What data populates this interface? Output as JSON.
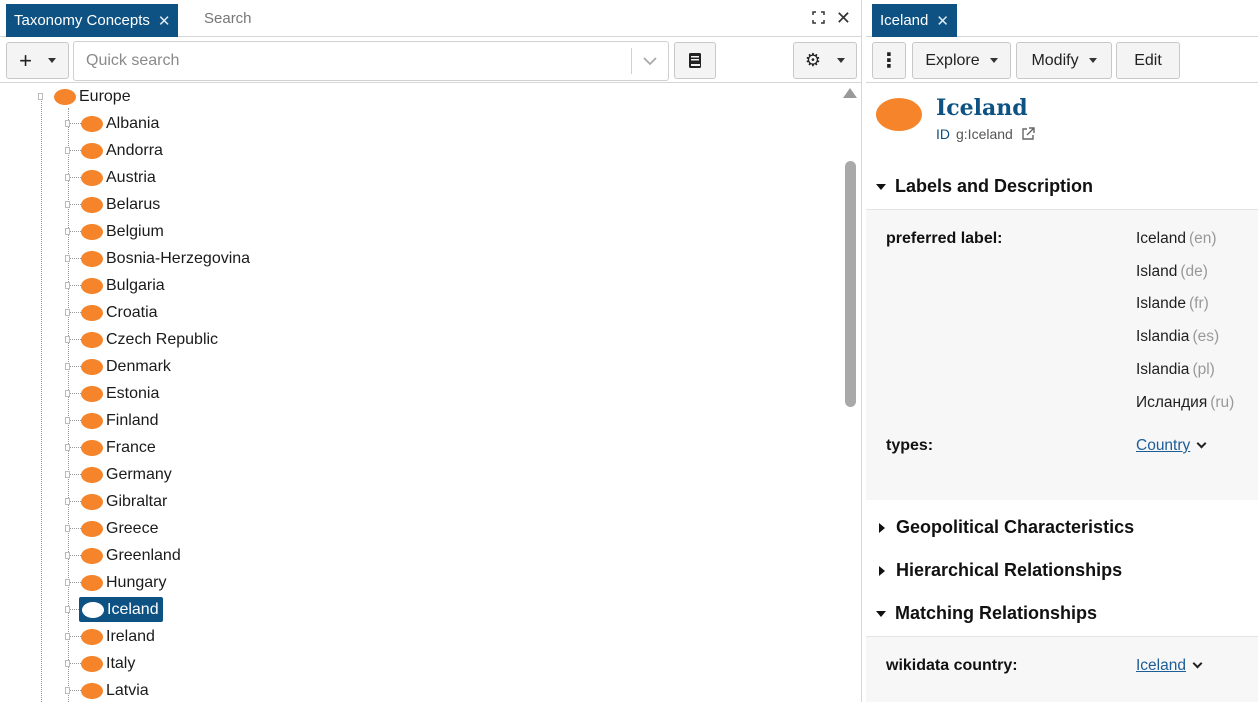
{
  "left_panel": {
    "tab_title": "Taxonomy Concepts",
    "tab_search_label": "Search",
    "quick_search_placeholder": "Quick search",
    "tree": {
      "root": "Europe",
      "children": [
        "Albania",
        "Andorra",
        "Austria",
        "Belarus",
        "Belgium",
        "Bosnia-Herzegovina",
        "Bulgaria",
        "Croatia",
        "Czech Republic",
        "Denmark",
        "Estonia",
        "Finland",
        "France",
        "Germany",
        "Gibraltar",
        "Greece",
        "Greenland",
        "Hungary",
        "Iceland",
        "Ireland",
        "Italy",
        "Latvia"
      ],
      "selected": "Iceland"
    }
  },
  "right_panel": {
    "tab_title": "Iceland",
    "toolbar": {
      "explore": "Explore",
      "modify": "Modify",
      "edit": "Edit"
    },
    "concept": {
      "title": "Iceland",
      "id_label": "ID",
      "id_value": "g:Iceland"
    },
    "sections": {
      "labels": "Labels and Description",
      "geopolitical": "Geopolitical Characteristics",
      "hierarchical": "Hierarchical Relationships",
      "matching": "Matching Relationships"
    },
    "preferred_label": {
      "label": "preferred label:",
      "values": [
        {
          "text": "Iceland",
          "lang": "(en)"
        },
        {
          "text": "Island",
          "lang": "(de)"
        },
        {
          "text": "Islande",
          "lang": "(fr)"
        },
        {
          "text": "Islandia",
          "lang": "(es)"
        },
        {
          "text": "Islandia",
          "lang": "(pl)"
        },
        {
          "text": "Исландия",
          "lang": "(ru)"
        }
      ]
    },
    "types": {
      "label": "types:",
      "value": "Country"
    },
    "wikidata_country": {
      "label": "wikidata country:",
      "value": "Iceland"
    }
  },
  "colors": {
    "accent": "#0d5282",
    "node": "#f5842a"
  }
}
